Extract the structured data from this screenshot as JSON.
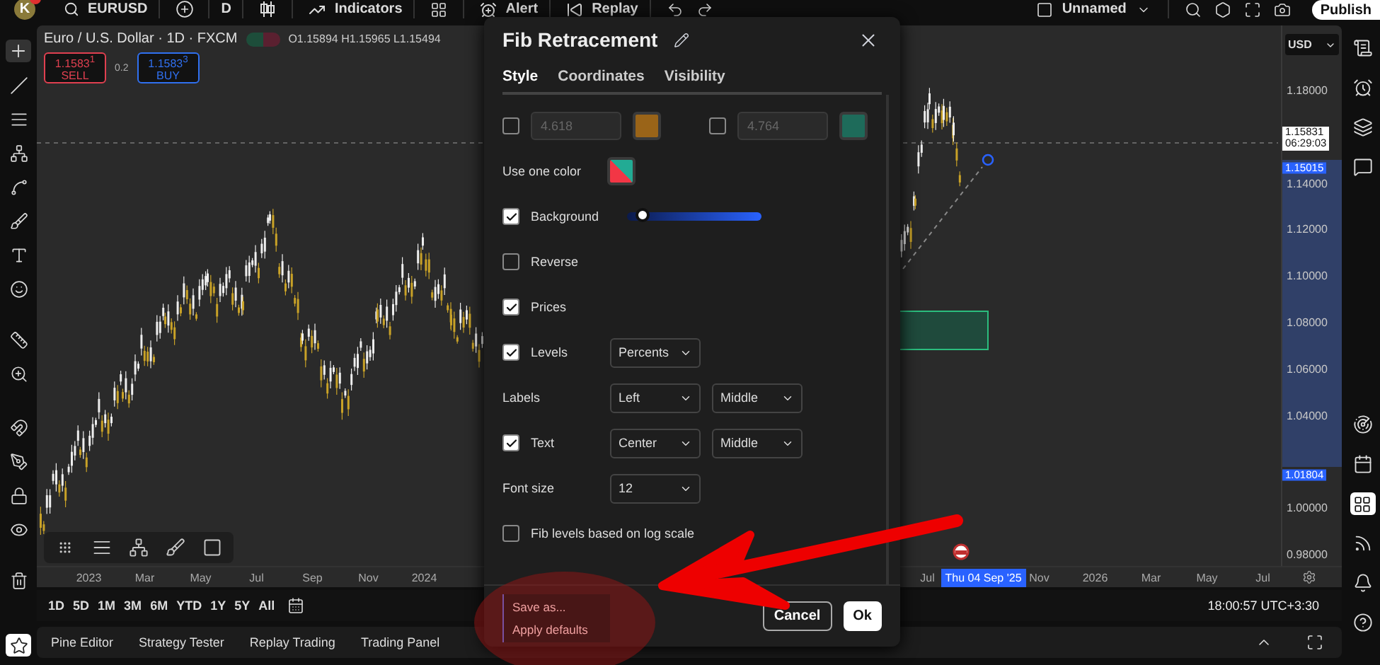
{
  "top_bar": {
    "avatar": "K",
    "symbol": "EURUSD",
    "interval": "D",
    "tools": [
      {
        "kind": "indicators",
        "label": "Indicators"
      },
      {
        "kind": "alert",
        "label": "Alert"
      },
      {
        "kind": "replay",
        "label": "Replay"
      }
    ],
    "layout_name": "Unnamed",
    "publish": "Publish"
  },
  "legend": {
    "title": "Euro / U.S. Dollar · 1D · FXCM",
    "ohlc": "O1.15894 H1.15965 L1.15494",
    "sell": {
      "price": "1.1583$^{1}$",
      "label": "SELL"
    },
    "spread": "0.2",
    "buy": {
      "price": "1.1583$^{3}$",
      "label": "BUY"
    }
  },
  "price_axis": {
    "currency": "USD",
    "ticks": [
      "1.18000",
      "1.14000",
      "1.12000",
      "1.10000",
      "1.08000",
      "1.06000",
      "1.04000",
      "1.00000",
      "0.98000"
    ],
    "last_price": "1.15831",
    "countdown": "06:29:03",
    "markers": [
      "1.15015",
      "1.01804"
    ]
  },
  "time_axis": {
    "left": [
      {
        "label": "2023",
        "highlighted": false
      },
      {
        "label": "Mar",
        "highlighted": false
      },
      {
        "label": "May",
        "highlighted": false
      },
      {
        "label": "Jul",
        "highlighted": false
      },
      {
        "label": "Sep",
        "highlighted": false
      },
      {
        "label": "Nov",
        "highlighted": false
      },
      {
        "label": "2024",
        "highlighted": false
      }
    ],
    "right": [
      {
        "label": "Jul",
        "highlighted": false
      },
      {
        "label": "Thu 04 Sep '25",
        "highlighted": true
      },
      {
        "label": "Nov",
        "highlighted": false
      },
      {
        "label": "2026",
        "highlighted": false
      },
      {
        "label": "Mar",
        "highlighted": false
      },
      {
        "label": "May",
        "highlighted": false
      },
      {
        "label": "Jul",
        "highlighted": false
      }
    ]
  },
  "range_bar": {
    "ranges": [
      "1D",
      "5D",
      "1M",
      "3M",
      "6M",
      "YTD",
      "1Y",
      "5Y",
      "All"
    ],
    "clock": "18:00:57 UTC+3:30"
  },
  "bottom_tabs": [
    "Pine Editor",
    "Strategy Tester",
    "Replay Trading",
    "Trading Panel"
  ],
  "dialog": {
    "title": "Fib Retracement",
    "tabs": [
      {
        "label": "Style",
        "selected": true
      },
      {
        "label": "Coordinates",
        "selected": false
      },
      {
        "label": "Visibility",
        "selected": false
      }
    ],
    "settings": [
      {
        "kind": "levels",
        "levels": [
          {
            "checked": false,
            "value": "4.618",
            "color": "#9a6418"
          },
          {
            "checked": false,
            "value": "4.764",
            "color": "#1e6b5a"
          }
        ]
      },
      {
        "kind": "color",
        "label": "Use one color"
      },
      {
        "kind": "slider",
        "label": "Background",
        "checked": true,
        "level": 0.12
      },
      {
        "kind": "checkbox",
        "label": "Reverse",
        "checked": false
      },
      {
        "kind": "checkbox",
        "label": "Prices",
        "checked": true
      },
      {
        "kind": "select",
        "label": "Levels",
        "checked": true,
        "selects": [
          "Percents"
        ]
      },
      {
        "kind": "select",
        "label": "Labels",
        "selects": [
          "Left",
          "Middle"
        ]
      },
      {
        "kind": "select",
        "label": "Text",
        "checked": true,
        "selects": [
          "Center",
          "Middle"
        ]
      },
      {
        "kind": "select",
        "label": "Font size",
        "selects": [
          "12"
        ]
      },
      {
        "kind": "checkbox",
        "label": "Fib levels based on log scale",
        "checked": false
      }
    ],
    "menu": [
      "Save as...",
      "Apply defaults"
    ],
    "cancel": "Cancel",
    "ok": "Ok"
  }
}
